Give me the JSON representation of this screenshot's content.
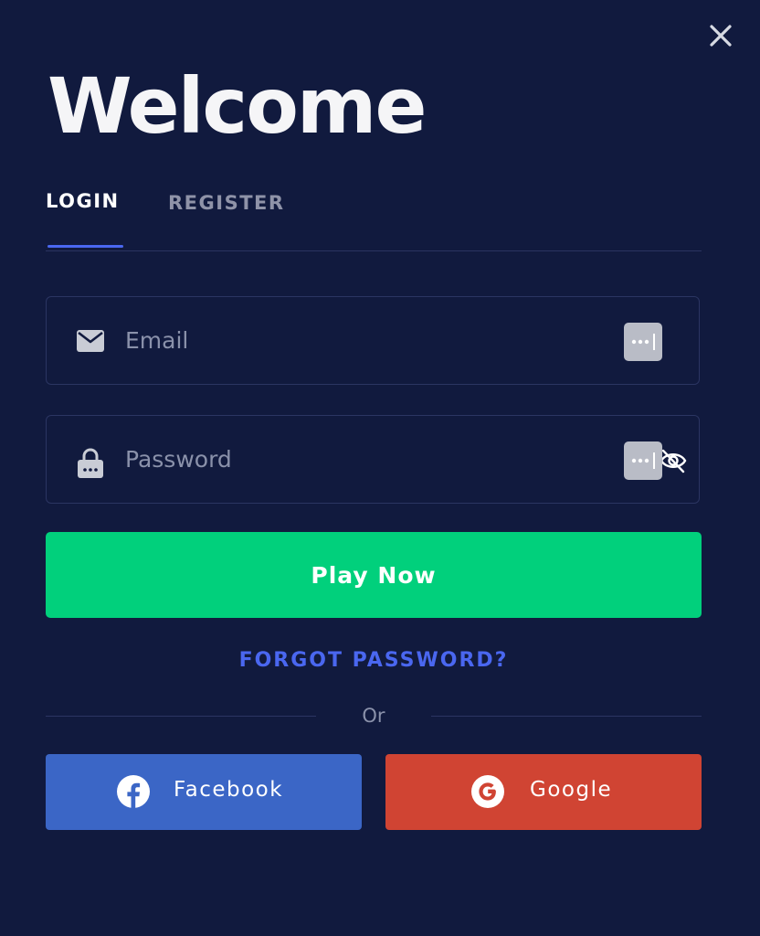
{
  "dialog": {
    "title": "Welcome",
    "close_icon": "close-icon"
  },
  "tabs": [
    {
      "label": "LOGIN",
      "active": true
    },
    {
      "label": "REGISTER",
      "active": false
    }
  ],
  "form": {
    "email": {
      "placeholder": "Email",
      "value": "",
      "icon": "mail-icon"
    },
    "password": {
      "placeholder": "Password",
      "value": "",
      "icon": "lock-icon",
      "toggle_icon": "eye-off-icon"
    },
    "submit_label": "Play Now",
    "forgot_label": "FORGOT PASSWORD?"
  },
  "divider": {
    "label": "Or"
  },
  "social": [
    {
      "label": "Facebook",
      "icon": "facebook-icon",
      "color": "#3b66c6"
    },
    {
      "label": "Google",
      "icon": "google-icon",
      "color": "#d04433"
    }
  ],
  "colors": {
    "background": "#111a3e",
    "accent": "#4a67f0",
    "primary_button": "#01d07c",
    "field_border": "#2b3562"
  }
}
